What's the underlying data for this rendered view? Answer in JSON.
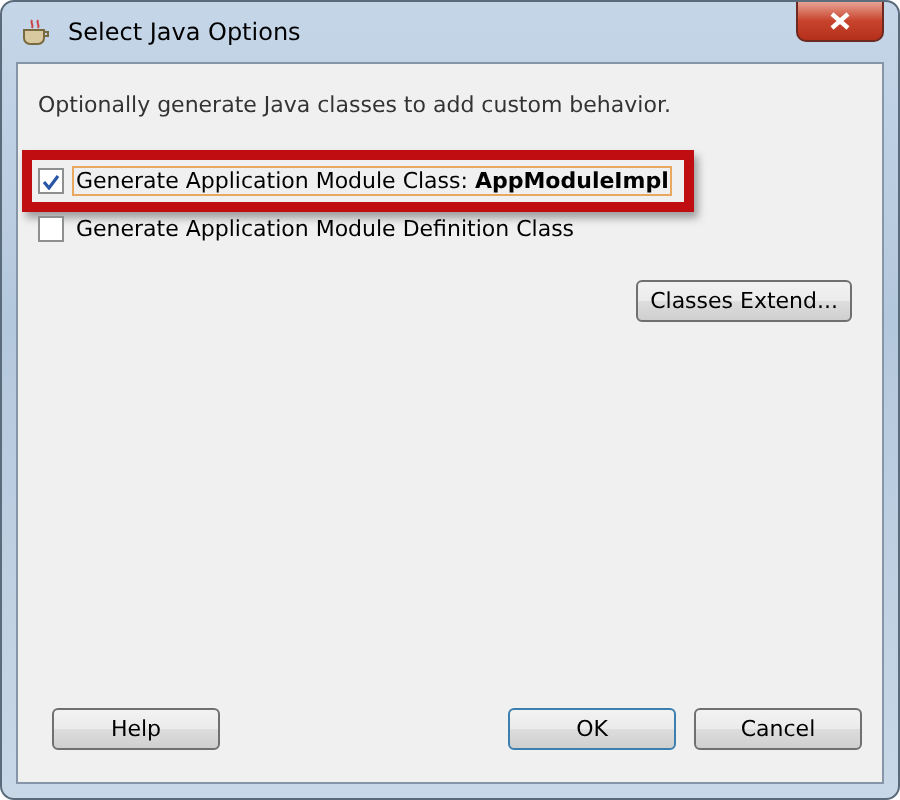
{
  "window": {
    "title": "Select Java Options"
  },
  "description": "Optionally generate Java classes to add custom behavior.",
  "options": [
    {
      "label": "Generate Application Module Class: **AppModuleImpl**",
      "checked": true,
      "highlighted": true
    },
    {
      "label": "Generate Application Module Definition Class",
      "checked": false,
      "highlighted": false
    }
  ],
  "side_button": "Classes Extend...",
  "buttons": [
    {
      "label": "Help",
      "kind": "help"
    },
    {
      "label": "OK",
      "kind": "default"
    },
    {
      "label": "Cancel",
      "kind": "normal"
    }
  ]
}
